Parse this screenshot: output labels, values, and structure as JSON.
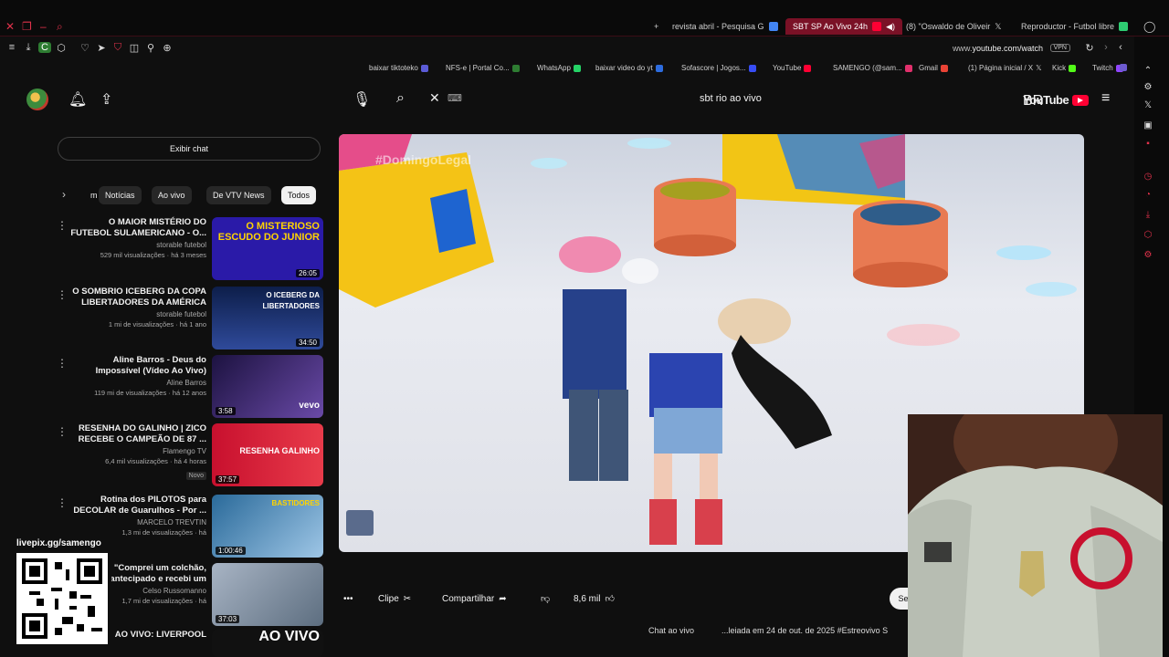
{
  "browser": {
    "tabs": [
      {
        "label": "Reproductor - Futbol libre",
        "color": "#2ecc71",
        "active": false
      },
      {
        "label": "(8) \"Oswaldo de Oliveir",
        "color": "#ffffff",
        "active": false
      },
      {
        "label": "SBT SP Ao Vivo 24h",
        "color": "#ff0033",
        "active": true
      },
      {
        "label": "revista abril - Pesquisa G",
        "color": "#4285f4",
        "active": false
      }
    ],
    "new_tab": "+",
    "url_domain": "www.",
    "url_path": "youtube.com/watch",
    "vpn_label": "VPN",
    "bookmarks": [
      {
        "label": "Twitch",
        "color": "#9146ff"
      },
      {
        "label": "Kick",
        "color": "#53fc18"
      },
      {
        "label": "(1) Página inicial / X",
        "color": "#ffffff"
      },
      {
        "label": "Gmail",
        "color": "#ea4335"
      },
      {
        "label": "SAMENGO (@sam...",
        "color": "#e1306c"
      },
      {
        "label": "YouTube",
        "color": "#ff0033"
      },
      {
        "label": "Sofascore | Jogos...",
        "color": "#374df5"
      },
      {
        "label": "baixar video do yt",
        "color": "#2d6cdf"
      },
      {
        "label": "WhatsApp",
        "color": "#25d366"
      },
      {
        "label": "NFS-e | Portal Co...",
        "color": "#2e7d32"
      },
      {
        "label": "baixar tiktoteko",
        "color": "#5b5bd6"
      }
    ]
  },
  "youtube": {
    "search_query": "sbt rio ao vivo",
    "logo_text": "YouTube",
    "country": "BR",
    "chat_button": "Exibir chat",
    "chips": [
      "Todos",
      "De VTV News",
      "Ao vivo",
      "Notícias",
      "m"
    ],
    "videos": [
      {
        "title": "O MAIOR MISTÉRIO DO FUTEBOL SULAMERICANO - O...",
        "channel": "storable futebol",
        "stats": "529 mil visualizações · há 3 meses",
        "duration": "26:05",
        "thumb_text": "O MISTERIOSO ESCUDO DO JUNIOR",
        "thumb_bg": "#2a1aa8",
        "badge": ""
      },
      {
        "title": "O SOMBRIO ICEBERG DA COPA LIBERTADORES DA AMÉRICA",
        "channel": "storable futebol",
        "stats": "1 mi de visualizações · há 1 ano",
        "duration": "34:50",
        "thumb_text": "O ICEBERG DA LIBERTADORES",
        "thumb_bg": "#1c2c6b",
        "badge": ""
      },
      {
        "title": "Aline Barros - Deus do Impossível (Vídeo Ao Vivo)",
        "channel": "Aline Barros",
        "stats": "119 mi de visualizações · há 12 anos",
        "duration": "3:58",
        "thumb_text": "vevo",
        "thumb_bg": "#3a2a6a",
        "badge": ""
      },
      {
        "title": "RESENHA DO GALINHO | ZICO RECEBE O CAMPEÃO DE 87 ...",
        "channel": "Flamengo TV",
        "stats": "6,4 mil visualizações · há 4 horas",
        "duration": "37:57",
        "thumb_text": "RESENHA GALINHO",
        "thumb_bg": "#c8102e",
        "badge": "Novo"
      },
      {
        "title": "Rotina dos PILOTOS para DECOLAR de Guarulhos - Por ...",
        "channel": "MARCELO TREVTIN",
        "stats": "1,3 mi de visualizações · há",
        "duration": "1:00:46",
        "thumb_text": "BASTIDORES",
        "thumb_bg": "#1f5f8b",
        "badge": ""
      },
      {
        "title": "\"Comprei um colchão, antecipado e recebi um",
        "channel": "Celso Russomanno",
        "stats": "1,7 mi de visualizações · há",
        "duration": "37:03",
        "thumb_text": "",
        "thumb_bg": "#7a8a9a",
        "badge": ""
      },
      {
        "title": "AO VIVO: LIVERPOOL",
        "channel": "",
        "stats": "",
        "duration": "",
        "thumb_text": "AO VIVO",
        "thumb_bg": "#111111",
        "badge": ""
      }
    ],
    "player": {
      "watermark": "#DomingoLegal"
    },
    "actions": {
      "likes": "8,6 mil",
      "share": "Compartilhar",
      "clip": "Clipe",
      "more": "•••",
      "subscribe": "Se"
    },
    "below": {
      "live_chat": "Chat ao vivo",
      "streamed": "...leiada em 24 de out. de 2025  #Estreovivo S"
    }
  },
  "overlay": {
    "qr_label": "livepix.gg/samengo"
  },
  "colors": {
    "accent": "#ff0033",
    "browser_accent": "#e0324b",
    "background": "#0f0f0f"
  }
}
